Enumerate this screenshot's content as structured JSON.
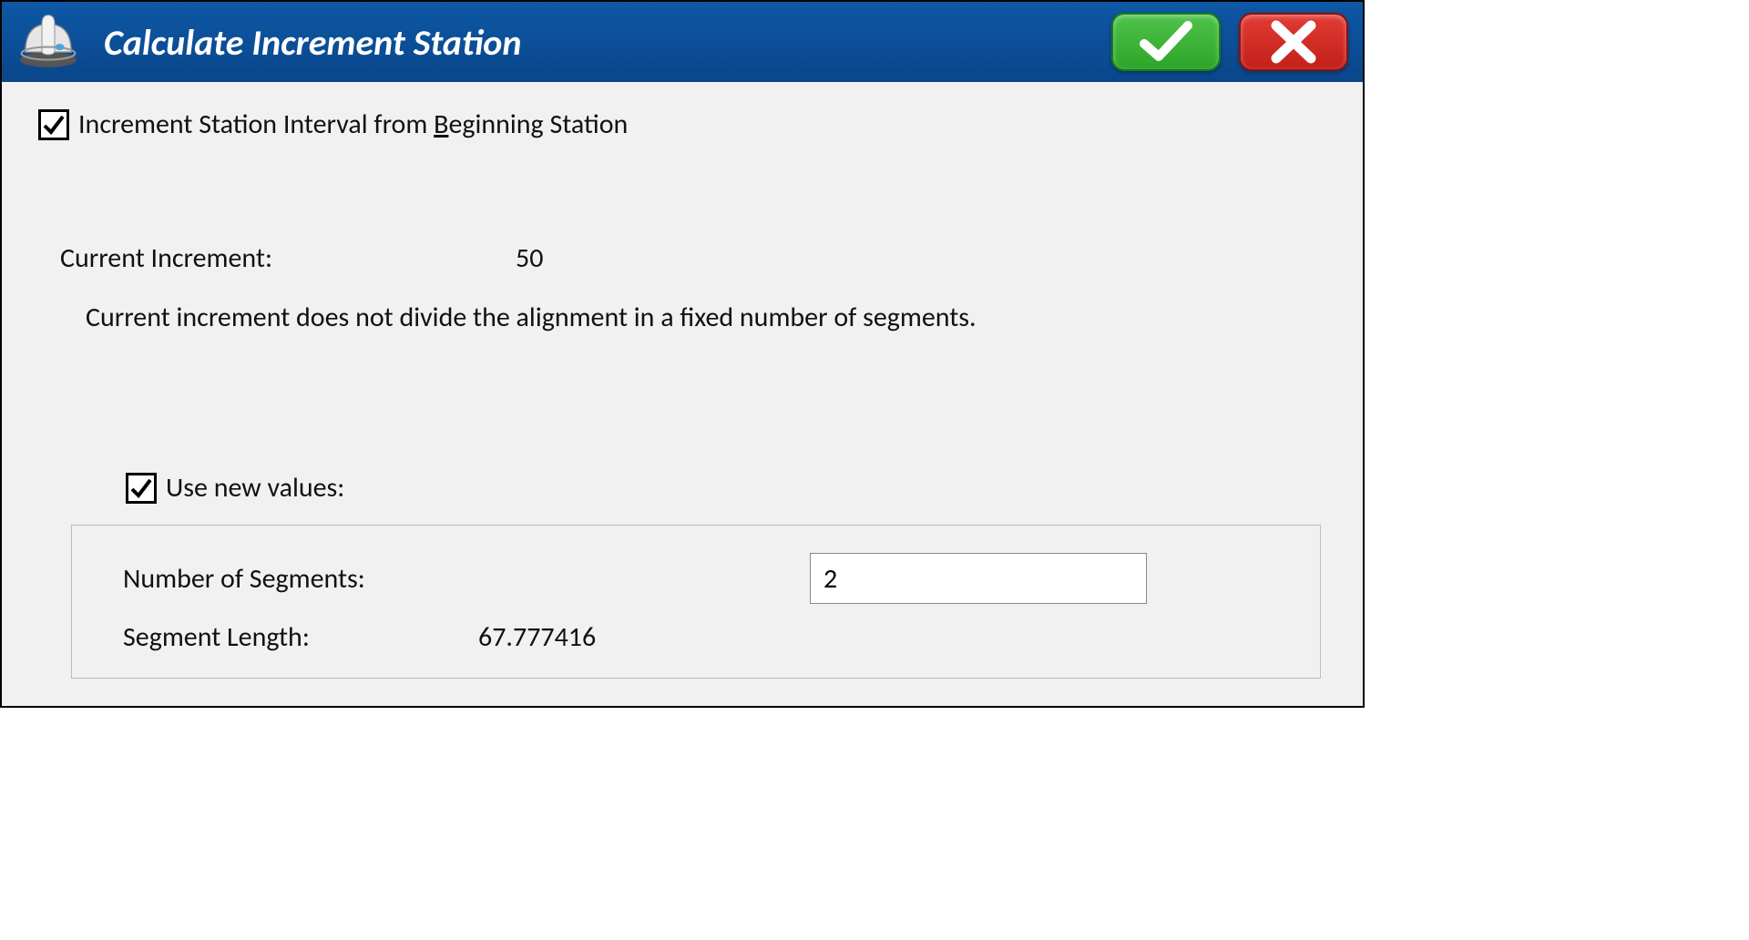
{
  "title": "Calculate Increment Station",
  "checkbox1": {
    "checked": true,
    "label_pre": "Increment Station Interval from ",
    "label_mnemonic": "B",
    "label_post": "eginning Station"
  },
  "current": {
    "label": "Current Increment:",
    "value": "50",
    "message": "Current increment does not divide the alignment in a fixed number of segments."
  },
  "useNew": {
    "checked": true,
    "label": "Use new values:"
  },
  "segments": {
    "count_label": "Number of Segments:",
    "count_value": "2",
    "length_label": "Segment Length:",
    "length_value": "67.777416"
  }
}
